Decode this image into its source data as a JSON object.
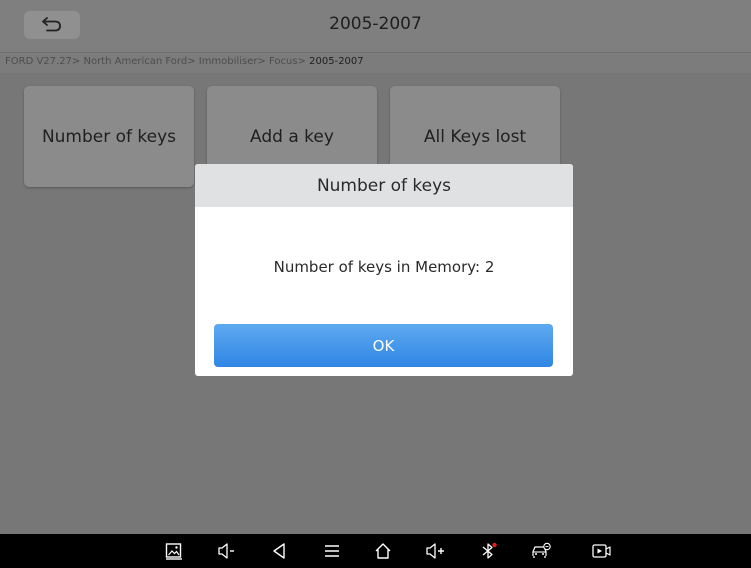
{
  "header": {
    "title": "2005-2007"
  },
  "breadcrumb": {
    "path": "FORD V27.27> North American Ford> Immobiliser> Focus> ",
    "current": "2005-2007"
  },
  "menu": {
    "items": [
      {
        "label": "Number of keys"
      },
      {
        "label": "Add a key"
      },
      {
        "label": "All Keys lost"
      }
    ]
  },
  "dialog": {
    "title": "Number of keys",
    "message": "Number of keys in Memory: 2",
    "ok_label": "OK"
  },
  "navbar": {
    "icons": [
      "screenshot-icon",
      "volume-down-icon",
      "back-icon",
      "menu-icon",
      "home-icon",
      "volume-up-icon",
      "bluetooth-icon",
      "car-diagnostic-icon",
      "screen-record-icon"
    ]
  },
  "colors": {
    "accent": "#3a8fe8",
    "overlay": "#777777",
    "dialog_header": "#dfe1e3",
    "bluetooth_dot": "#e02020"
  }
}
